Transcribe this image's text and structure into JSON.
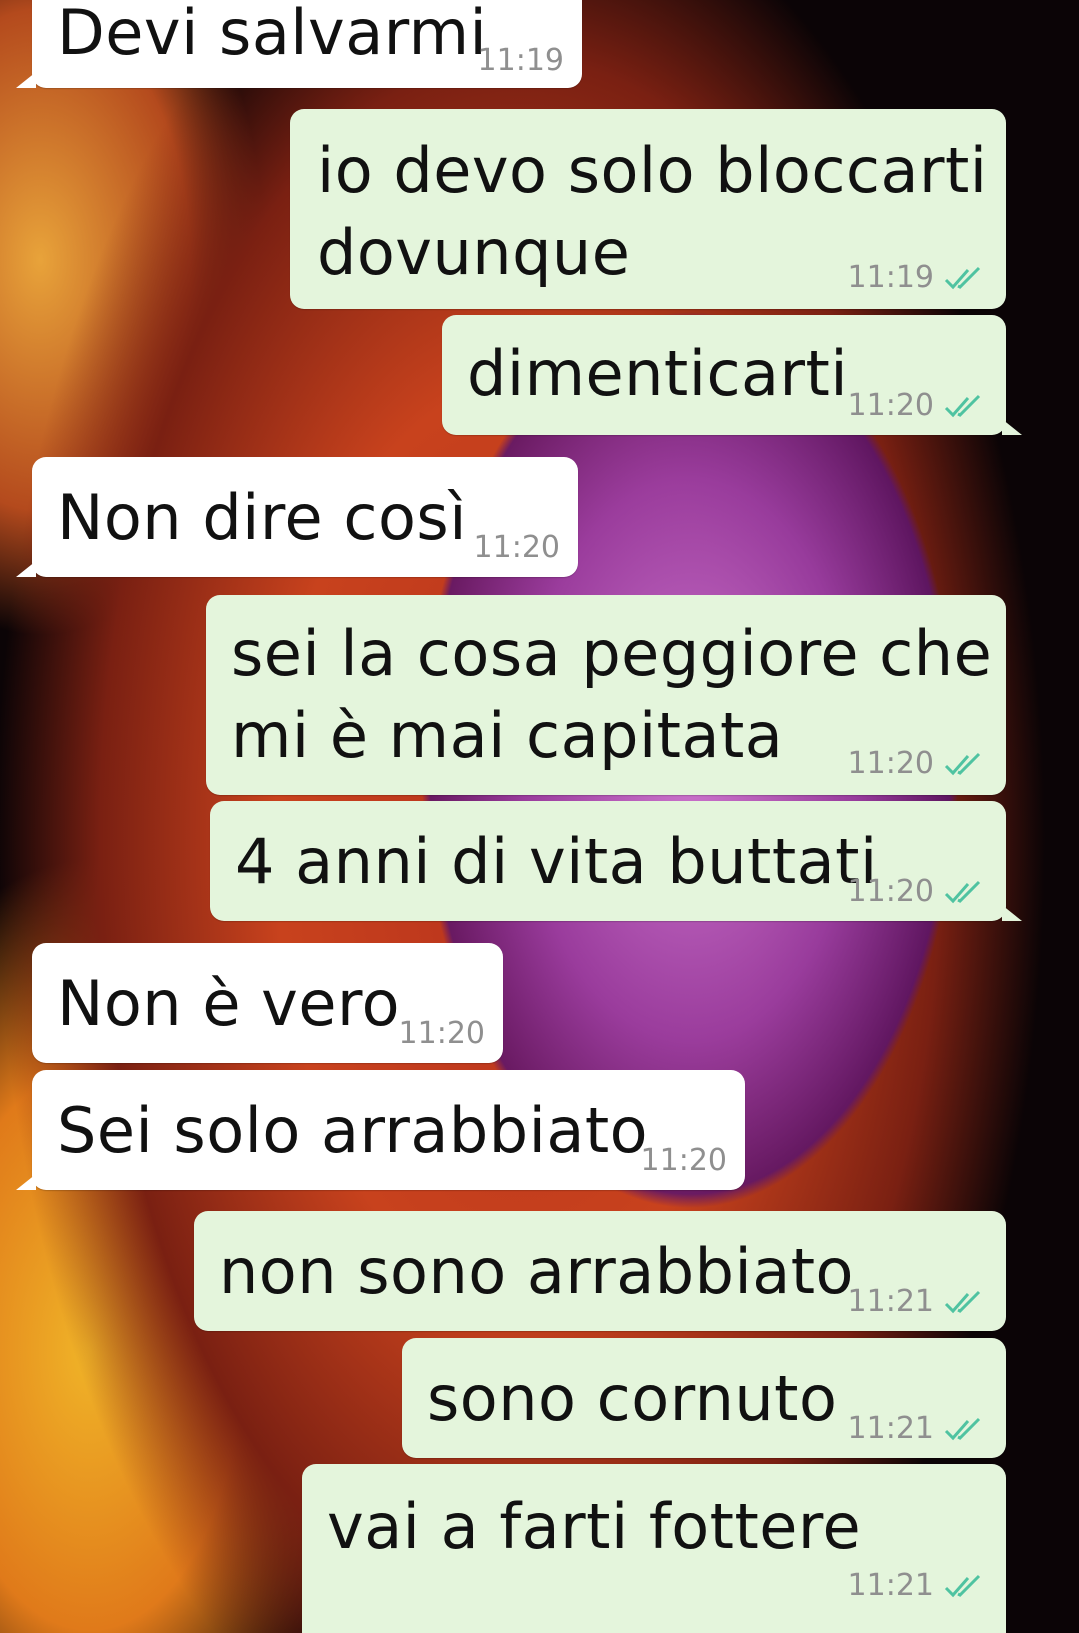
{
  "colors": {
    "incoming_bubble": "#ffffff",
    "outgoing_bubble": "#e4f5dc",
    "read_tick": "#4fc3a1",
    "timestamp": "#8f8f8f"
  },
  "messages": [
    {
      "direction": "in",
      "text": "Devi salvarmi",
      "time": "11:19"
    },
    {
      "direction": "out",
      "text": "io devo solo bloccarti\ndovunque",
      "time": "11:19",
      "status_icon": "double-check-icon"
    },
    {
      "direction": "out",
      "text": "dimenticarti",
      "time": "11:20",
      "status_icon": "double-check-icon"
    },
    {
      "direction": "in",
      "text": "Non dire così",
      "time": "11:20"
    },
    {
      "direction": "out",
      "text": "sei la cosa peggiore che\nmi è mai capitata",
      "time": "11:20",
      "status_icon": "double-check-icon"
    },
    {
      "direction": "out",
      "text": "4 anni di vita buttati",
      "time": "11:20",
      "status_icon": "double-check-icon"
    },
    {
      "direction": "in",
      "text": "Non è vero",
      "time": "11:20"
    },
    {
      "direction": "in",
      "text": "Sei solo arrabbiato",
      "time": "11:20"
    },
    {
      "direction": "out",
      "text": "non sono arrabbiato",
      "time": "11:21",
      "status_icon": "double-check-icon"
    },
    {
      "direction": "out",
      "text": "sono cornuto",
      "time": "11:21",
      "status_icon": "double-check-icon"
    },
    {
      "direction": "out",
      "text": "vai a farti fottere",
      "time": "11:21",
      "status_icon": "double-check-icon"
    }
  ]
}
